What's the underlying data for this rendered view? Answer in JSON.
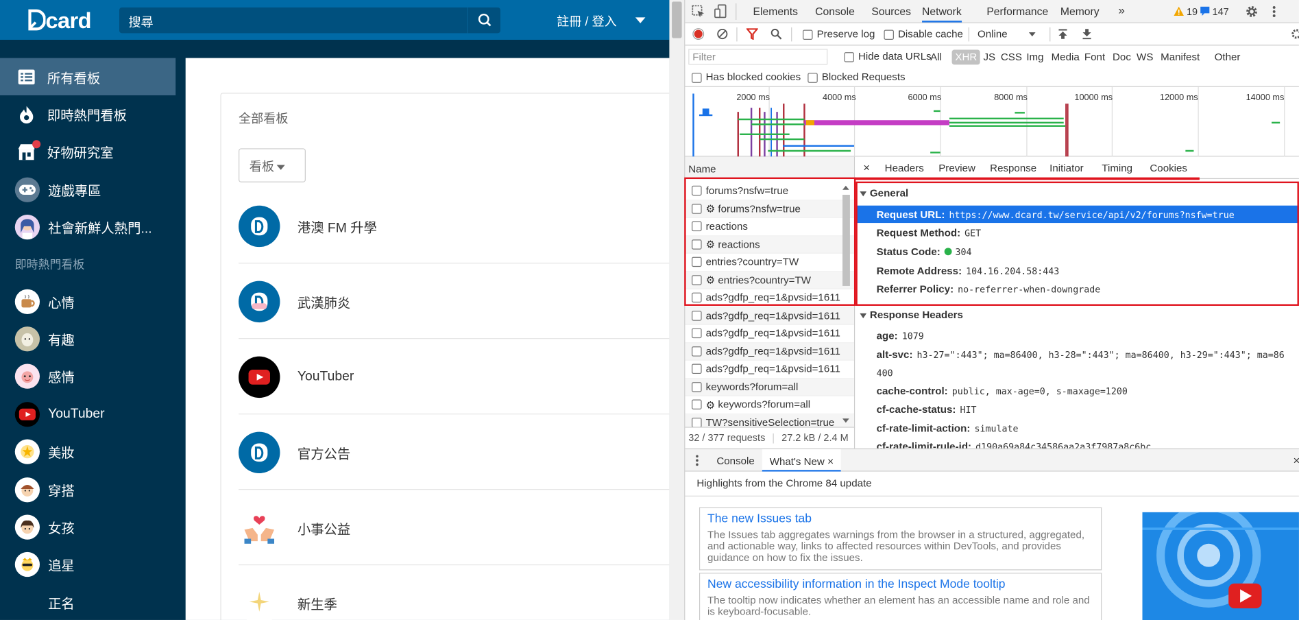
{
  "dcard": {
    "brand": "card",
    "search_placeholder": "搜尋",
    "login_label": "註冊 / 登入",
    "sidebar": {
      "items": [
        {
          "label": "所有看板"
        },
        {
          "label": "即時熱門看板"
        },
        {
          "label": "好物研究室"
        },
        {
          "label": "遊戲專區"
        },
        {
          "label": "社會新鮮人熱門..."
        }
      ],
      "section_label": "即時熱門看板",
      "boards": [
        {
          "label": "心情"
        },
        {
          "label": "有趣"
        },
        {
          "label": "感情"
        },
        {
          "label": "YouTuber"
        },
        {
          "label": "美妝"
        },
        {
          "label": "穿搭"
        },
        {
          "label": "女孩"
        },
        {
          "label": "追星"
        },
        {
          "label": "正名"
        }
      ]
    },
    "main": {
      "card_title": "全部看板",
      "select_label": "看板",
      "forums": [
        {
          "name": "港澳 FM 升學"
        },
        {
          "name": "武漢肺炎"
        },
        {
          "name": "YouTuber"
        },
        {
          "name": "官方公告"
        },
        {
          "name": "小事公益"
        },
        {
          "name": "新生季"
        }
      ]
    }
  },
  "devtools": {
    "tabs": [
      "Elements",
      "Console",
      "Sources",
      "Network",
      "Performance",
      "Memory"
    ],
    "more_label": "»",
    "warnings_count": "19",
    "messages_count": "147",
    "toolbar": {
      "preserve_log": "Preserve log",
      "disable_cache": "Disable cache",
      "throttle": "Online"
    },
    "filter": {
      "placeholder": "Filter",
      "hide_data_urls": "Hide data URLs",
      "types": [
        "All",
        "XHR",
        "JS",
        "CSS",
        "Img",
        "Media",
        "Font",
        "Doc",
        "WS",
        "Manifest",
        "Other"
      ],
      "has_blocked_cookies": "Has blocked cookies",
      "blocked_requests": "Blocked Requests"
    },
    "overview_ticks": [
      "2000 ms",
      "4000 ms",
      "6000 ms",
      "8000 ms",
      "10000 ms",
      "12000 ms",
      "14000 ms"
    ],
    "name_header": "Name",
    "requests": [
      {
        "name": "forums?nsfw=true",
        "gear": false
      },
      {
        "name": "forums?nsfw=true",
        "gear": true
      },
      {
        "name": "reactions",
        "gear": false
      },
      {
        "name": "reactions",
        "gear": true
      },
      {
        "name": "entries?country=TW",
        "gear": false
      },
      {
        "name": "entries?country=TW",
        "gear": true
      },
      {
        "name": "ads?gdfp_req=1&pvsid=1611",
        "gear": false
      },
      {
        "name": "ads?gdfp_req=1&pvsid=1611",
        "gear": false
      },
      {
        "name": "ads?gdfp_req=1&pvsid=1611",
        "gear": false
      },
      {
        "name": "ads?gdfp_req=1&pvsid=1611",
        "gear": false
      },
      {
        "name": "ads?gdfp_req=1&pvsid=1611",
        "gear": false
      },
      {
        "name": "keywords?forum=all",
        "gear": false
      },
      {
        "name": "keywords?forum=all",
        "gear": true
      },
      {
        "name": "TW?sensitiveSelection=true",
        "gear": false
      }
    ],
    "status_bar": {
      "requests": "32 / 377 requests",
      "transferred": "27.2 kB / 2.4 M"
    },
    "detail_tabs": [
      "Headers",
      "Preview",
      "Response",
      "Initiator",
      "Timing",
      "Cookies"
    ],
    "general": {
      "title": "General",
      "request_url_k": "Request URL:",
      "request_url_v": "https://www.dcard.tw/service/api/v2/forums?nsfw=true",
      "method_k": "Request Method:",
      "method_v": "GET",
      "status_k": "Status Code:",
      "status_v": "304",
      "remote_k": "Remote Address:",
      "remote_v": "104.16.204.58:443",
      "referrer_k": "Referrer Policy:",
      "referrer_v": "no-referrer-when-downgrade"
    },
    "response_headers": {
      "title": "Response Headers",
      "age_k": "age:",
      "age_v": "1079",
      "altsvc_k": "alt-svc:",
      "altsvc_v": "h3-27=\":443\"; ma=86400, h3-28=\":443\"; ma=86400, h3-29=\":443\"; ma=86",
      "altsvc_v2": "400",
      "cache_k": "cache-control:",
      "cache_v": "public, max-age=0, s-maxage=1200",
      "cfcache_k": "cf-cache-status:",
      "cfcache_v": "HIT",
      "cfrate_k": "cf-rate-limit-action:",
      "cfrate_v": "simulate",
      "cfrule_k": "cf-rate-limit-rule-id:",
      "cfrule_v": "d190a69a84c34586aa2a3f7987a8c6bc"
    },
    "drawer": {
      "console_tab": "Console",
      "whats_new_tab": "What's New",
      "highlights": "Highlights from the Chrome 84 update",
      "cards": [
        {
          "title": "The new Issues tab",
          "desc": "The Issues tab aggregates warnings from the browser in a structured, aggregated, and actionable way, links to affected resources within DevTools, and provides guidance on how to fix the issues."
        },
        {
          "title": "New accessibility information in the Inspect Mode tooltip",
          "desc": "The tooltip now indicates whether an element has an accessible name and role and is keyboard-focusable."
        }
      ]
    },
    "colors": {
      "accent": "#1a73e8",
      "red_box": "#e0141e",
      "status_green": "#2ab24a"
    }
  }
}
